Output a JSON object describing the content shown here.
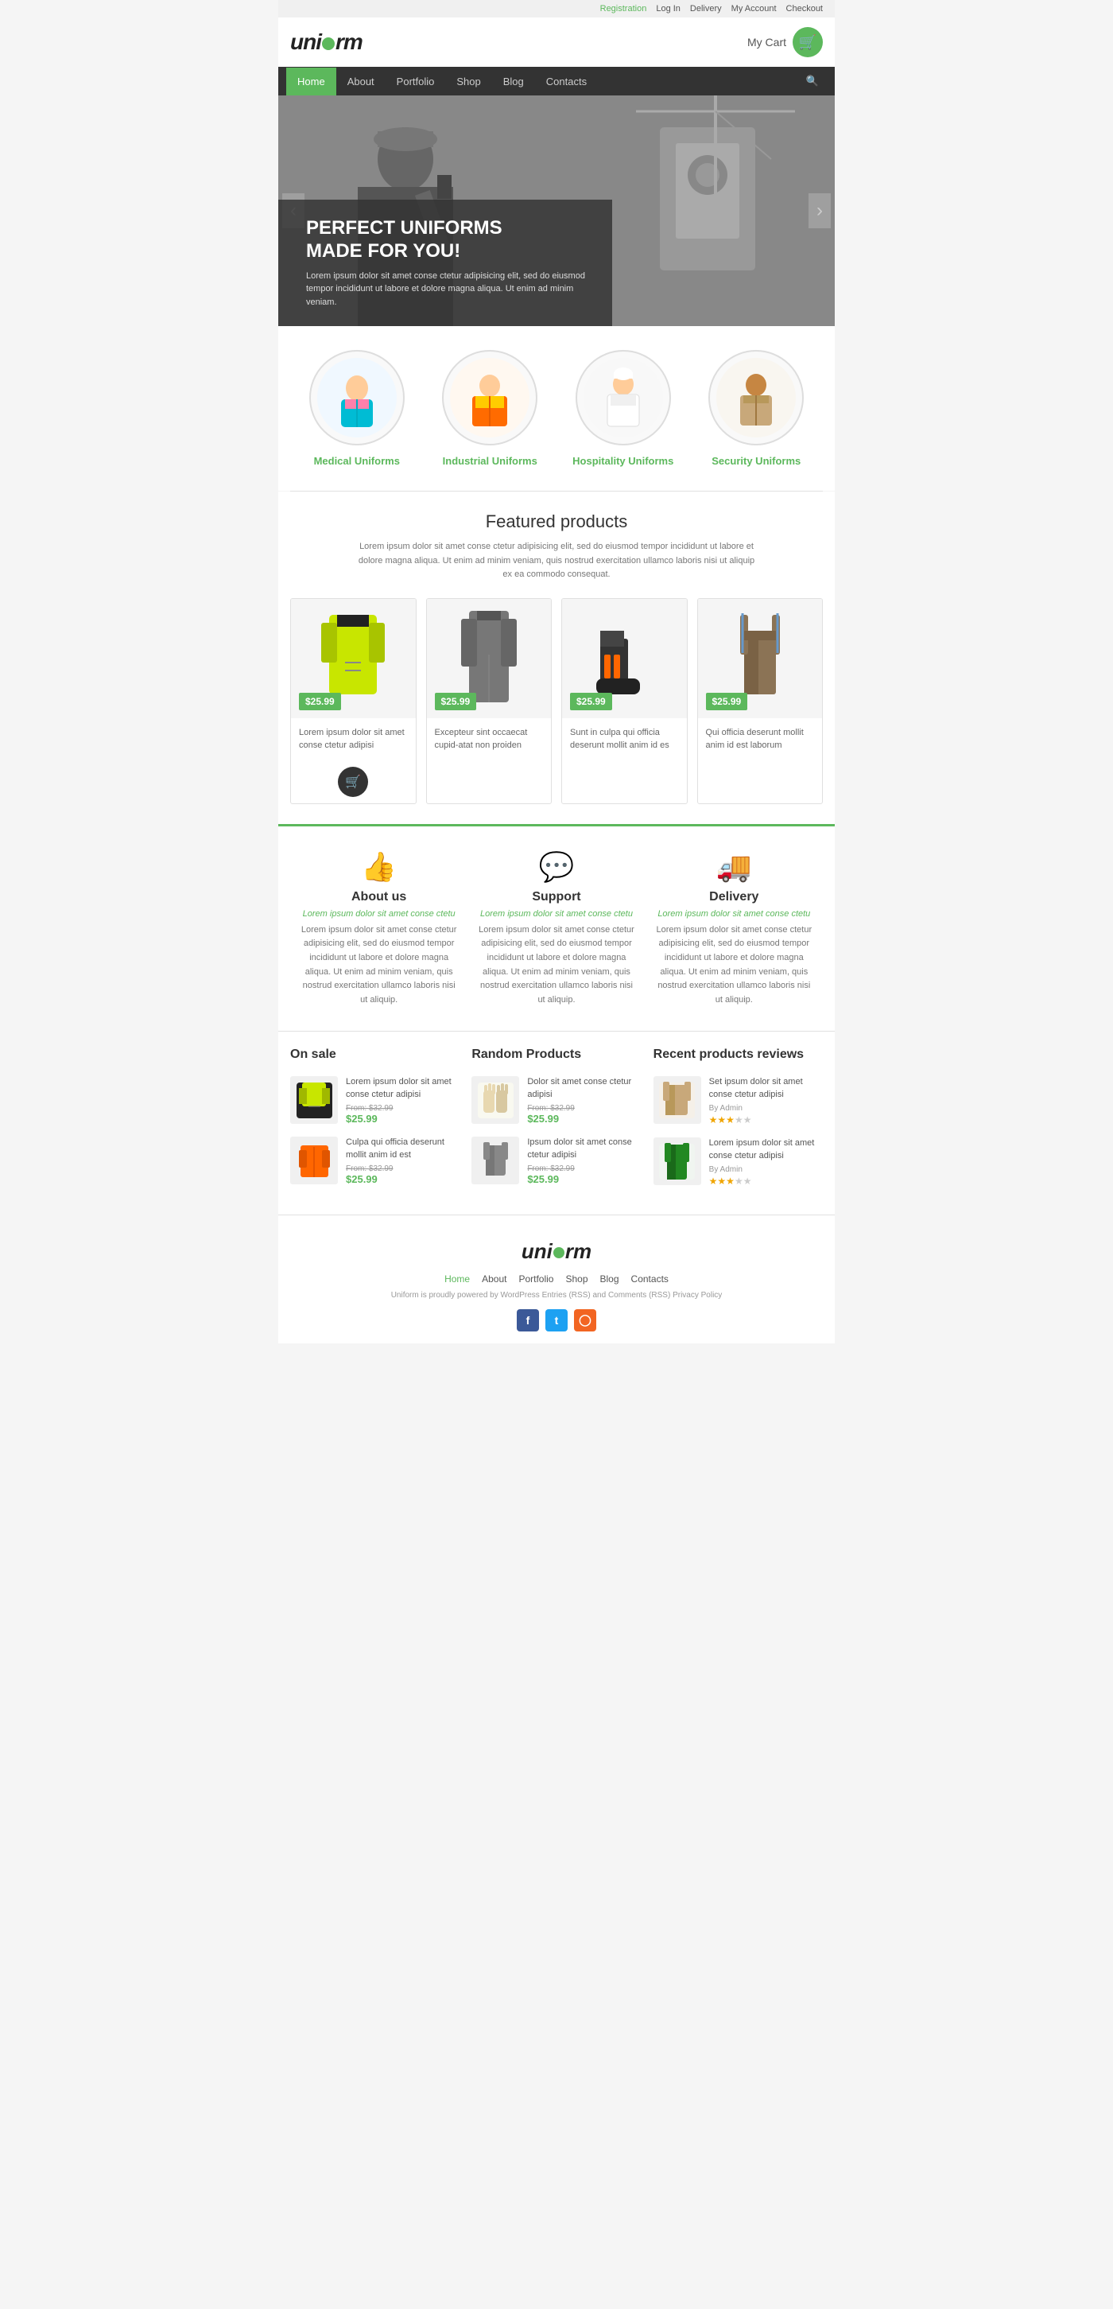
{
  "topbar": {
    "links": [
      "Registration",
      "Log In",
      "Delivery",
      "My Account",
      "Checkout"
    ]
  },
  "header": {
    "logo": "uniform",
    "cart_label": "My Cart"
  },
  "nav": {
    "items": [
      "Home",
      "About",
      "Portfolio",
      "Shop",
      "Blog",
      "Contacts"
    ]
  },
  "hero": {
    "title": "PERFECT UNIFORMS\nMADE FOR YOU!",
    "text": "Lorem ipsum dolor sit amet conse ctetur adipisicing elit, sed do eiusmod tempor incididunt ut labore et dolore magna aliqua. Ut enim ad minim veniam."
  },
  "categories": [
    {
      "label": "Medical",
      "suffix": " Uniforms",
      "emoji": "👩‍⚕️"
    },
    {
      "label": "Industrial",
      "suffix": " Uniforms",
      "emoji": "🦺"
    },
    {
      "label": "Hospitality",
      "suffix": " Uniforms",
      "emoji": "👨‍🍳"
    },
    {
      "label": "Security",
      "suffix": " Uniforms",
      "emoji": "💂"
    }
  ],
  "featured": {
    "title": "Featured products",
    "desc": "Lorem ipsum dolor sit amet conse ctetur adipisicing elit, sed do eiusmod tempor incididunt ut labore et dolore magna aliqua. Ut enim ad minim veniam, quis nostrud exercitation ullamco laboris nisi ut aliquip ex ea commodo consequat.",
    "products": [
      {
        "price": "$25.99",
        "desc": "Lorem ipsum dolor sit amet conse ctetur adipisi",
        "emoji": "🧥"
      },
      {
        "price": "$25.99",
        "desc": "Excepteur sint occaecat cupid-atat non proiden",
        "emoji": "👔"
      },
      {
        "price": "$25.99",
        "desc": "Sunt in culpa qui officia deserunt mollit anim id es",
        "emoji": "👢"
      },
      {
        "price": "$25.99",
        "desc": "Qui officia deserunt mollit anim id est laborum",
        "emoji": "👖"
      }
    ]
  },
  "info": [
    {
      "icon": "👍",
      "title": "About us",
      "subtitle": "Lorem ipsum dolor sit amet conse ctetu",
      "text": "Lorem ipsum dolor sit amet conse ctetur adipisicing elit, sed do eiusmod tempor incididunt ut labore et dolore magna aliqua. Ut enim ad minim veniam, quis nostrud exercitation ullamco laboris nisi ut aliquip."
    },
    {
      "icon": "💬",
      "title": "Support",
      "subtitle": "Lorem ipsum dolor sit amet conse ctetu",
      "text": "Lorem ipsum dolor sit amet conse ctetur adipisicing elit, sed do eiusmod tempor incididunt ut labore et dolore magna aliqua. Ut enim ad minim veniam, quis nostrud exercitation ullamco laboris nisi ut aliquip."
    },
    {
      "icon": "🚚",
      "title": "Delivery",
      "subtitle": "Lorem ipsum dolor sit amet conse ctetu",
      "text": "Lorem ipsum dolor sit amet conse ctetur adipisicing elit, sed do eiusmod tempor incididunt ut labore et dolore magna aliqua. Ut enim ad minim veniam, quis nostrud exercitation ullamco laboris nisi ut aliquip."
    }
  ],
  "on_sale": {
    "title": "On sale",
    "products": [
      {
        "emoji": "🧥",
        "name": "Lorem ipsum dolor sit amet conse ctetur adipisi",
        "old_price": "$32.99",
        "price": "$25.99"
      },
      {
        "emoji": "🧡",
        "name": "Culpa qui officia deserunt mollit anim id est",
        "old_price": "$32.99",
        "price": "$25.99"
      }
    ]
  },
  "random_products": {
    "title": "Random Products",
    "products": [
      {
        "emoji": "🧤",
        "name": "Dolor sit amet conse ctetur adipisi",
        "old_price": "$32.99",
        "price": "$25.99"
      },
      {
        "emoji": "👗",
        "name": "Ipsum dolor sit amet conse ctetur adipisi",
        "old_price": "$32.99",
        "price": "$25.99"
      }
    ]
  },
  "recent_reviews": {
    "title": "Recent products reviews",
    "products": [
      {
        "emoji": "👖",
        "name": "Set ipsum dolor sit amet conse ctetur adipisi",
        "by": "By Admin",
        "stars": 3
      },
      {
        "emoji": "🧥",
        "name": "Lorem ipsum dolor sit amet conse ctetur adipisi",
        "by": "By Admin",
        "stars": 3
      }
    ]
  },
  "footer": {
    "logo": "uniform",
    "nav_items": [
      {
        "label": "Home",
        "highlight": true
      },
      {
        "label": "About",
        "highlight": false
      },
      {
        "label": "Portfolio",
        "highlight": false
      },
      {
        "label": "Shop",
        "highlight": false
      },
      {
        "label": "Blog",
        "highlight": false
      },
      {
        "label": "Contacts",
        "highlight": false
      }
    ],
    "credit": "Uniform is proudly powered by WordPress Entries (RSS) and Comments (RSS) Privacy Policy"
  }
}
